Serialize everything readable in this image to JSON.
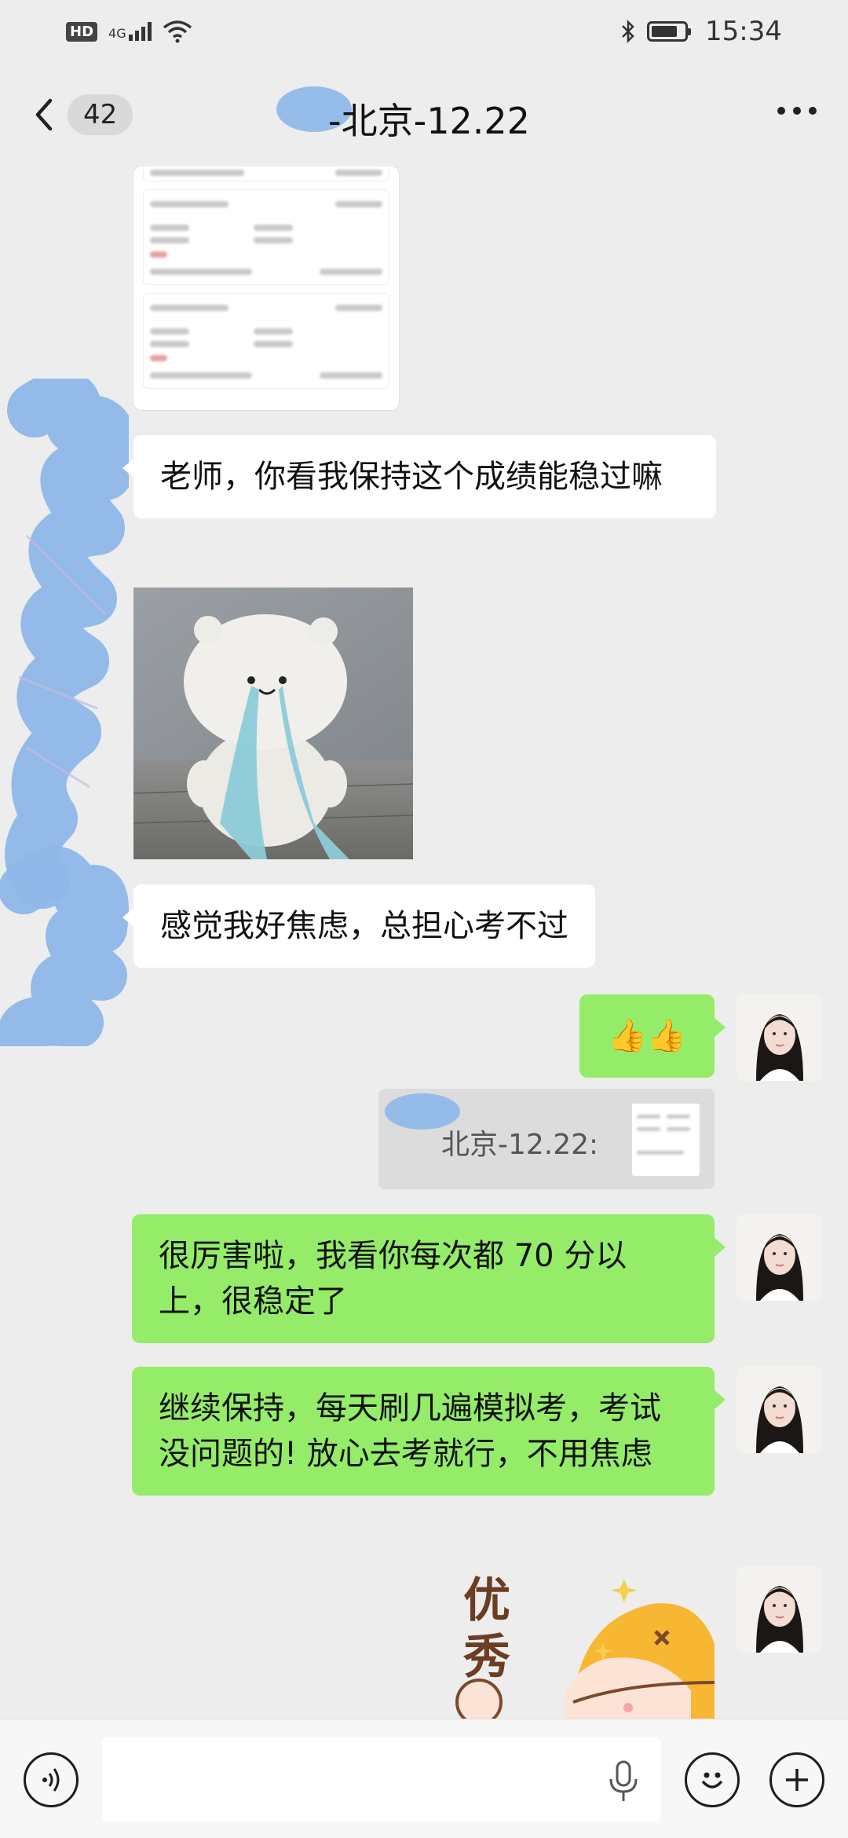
{
  "status_bar": {
    "hd": "HD",
    "network": "4G",
    "time": "15:34"
  },
  "header": {
    "unread_count": "42",
    "title": "-北京-12.22",
    "more_icon": "more-dots-icon",
    "back_icon": "chevron-left-icon"
  },
  "messages": [
    {
      "side": "left",
      "type": "image",
      "content": "blurred score screenshot"
    },
    {
      "side": "left",
      "type": "text",
      "text": "老师，你看我保持这个成绩能稳过嘛"
    },
    {
      "side": "left",
      "type": "image",
      "content": "crying bear plush"
    },
    {
      "side": "left",
      "type": "text",
      "text": "感觉我好焦虑，总担心考不过"
    },
    {
      "side": "right",
      "type": "text",
      "text": "👍👍"
    },
    {
      "side": "right",
      "type": "quote",
      "text": "北京-12.22:"
    },
    {
      "side": "right",
      "type": "text",
      "text": "很厉害啦，我看你每次都 70 分以上，很稳定了"
    },
    {
      "side": "right",
      "type": "text",
      "text": "继续保持，每天刷几遍模拟考，考试没问题的! 放心去考就行，不用焦虑"
    },
    {
      "side": "right",
      "type": "sticker",
      "text": "优秀"
    }
  ],
  "input_bar": {
    "voice_icon": "voice-input-icon",
    "mic_icon": "microphone-icon",
    "emoji_icon": "emoji-icon",
    "plus_icon": "plus-icon",
    "placeholder": ""
  },
  "colors": {
    "background": "#ededed",
    "my_bubble": "#95ec69",
    "their_bubble": "#ffffff",
    "scribble": "#8eb7e8"
  }
}
